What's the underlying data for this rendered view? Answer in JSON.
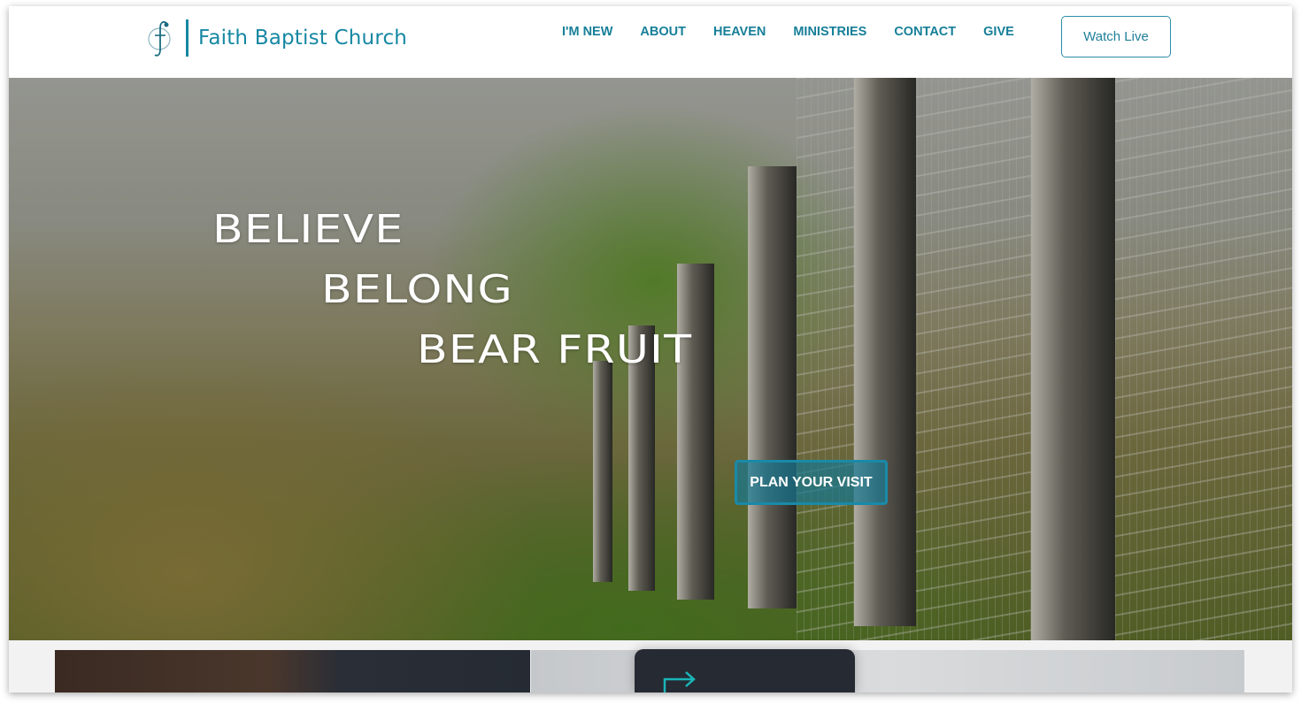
{
  "header": {
    "brand": "Faith Baptist Church",
    "nav": [
      "I'M NEW",
      "ABOUT",
      "HEAVEN",
      "MINISTRIES",
      "CONTACT",
      "GIVE"
    ],
    "watch_live": "Watch Live"
  },
  "hero": {
    "lines": [
      "BELIEVE",
      "BELONG",
      "BEAR FRUIT"
    ],
    "cta": "PLAN YOUR VISIT"
  },
  "colors": {
    "brand": "#1688a3",
    "cta": "#1a8aa8",
    "card_arrow": "#19b5b8"
  },
  "icons": {
    "logo": "cross-f-logo",
    "card": "redirect-arrow-icon"
  }
}
